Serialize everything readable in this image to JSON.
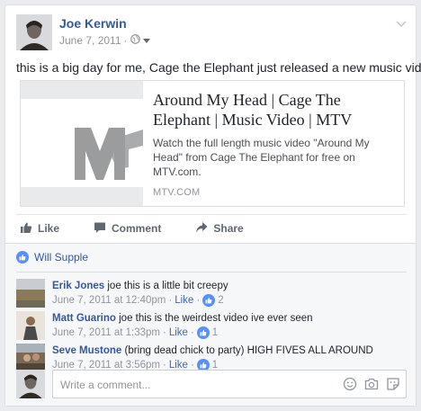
{
  "post": {
    "author": "Joe Kerwin",
    "date": "June 7, 2011",
    "separator": "·",
    "text": "this is a big day for me, Cage the Elephant just released a new music video",
    "link": {
      "title": "Around My Head | Cage The Elephant | Music Video | MTV",
      "description": "Watch the full length music video \"Around My Head\" from Cage The Elephant for free on MTV.com.",
      "domain": "MTV.COM"
    }
  },
  "actions": {
    "like": "Like",
    "comment": "Comment",
    "share": "Share"
  },
  "likes": {
    "name": "Will Supple"
  },
  "comments": [
    {
      "author": "Erik Jones",
      "text": "joe this is a little bit creepy",
      "date": "June 7, 2011 at 12:40pm",
      "like_label": "Like",
      "like_count": "2"
    },
    {
      "author": "Matt Guarino",
      "text": "joe this is the weirdest video ive ever seen",
      "date": "June 7, 2011 at 1:33pm",
      "like_label": "Like",
      "like_count": "1"
    },
    {
      "author": "Seve Mustone",
      "text": "(bring dead chick to party) HIGH FIVES ALL AROUND",
      "date": "June 7, 2011 at 3:56pm",
      "like_label": "Like",
      "like_count": "1"
    }
  ],
  "write": {
    "placeholder": "Write a comment..."
  },
  "colors": {
    "link_blue": "#365899",
    "like_blue": "#5890ff",
    "muted": "#90949c"
  }
}
